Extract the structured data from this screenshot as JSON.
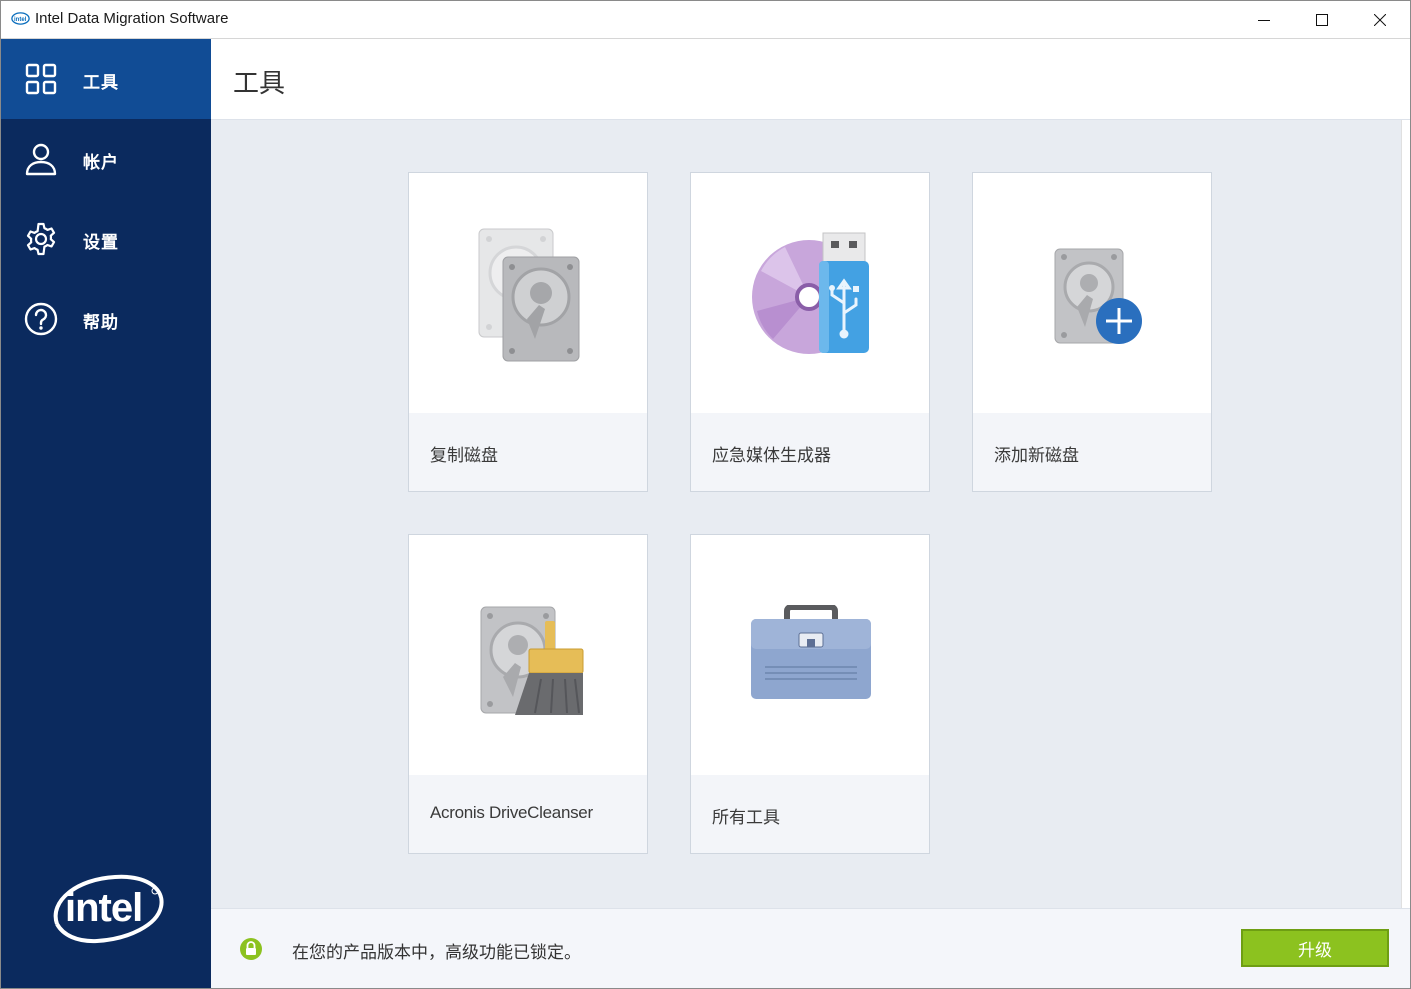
{
  "window": {
    "title": "Intel Data Migration Software"
  },
  "sidebar": {
    "items": [
      {
        "label": "工具",
        "icon": "grid-icon",
        "active": true
      },
      {
        "label": "帐户",
        "icon": "user-icon"
      },
      {
        "label": "设置",
        "icon": "gear-icon"
      },
      {
        "label": "帮助",
        "icon": "help-icon"
      }
    ],
    "logo": "intel"
  },
  "header": {
    "title": "工具"
  },
  "tools": [
    {
      "label": "复制磁盘",
      "icon": "clone-disk-icon"
    },
    {
      "label": "应急媒体生成器",
      "icon": "rescue-media-icon"
    },
    {
      "label": "添加新磁盘",
      "icon": "add-disk-icon"
    },
    {
      "label": "Acronis DriveCleanser",
      "icon": "drive-cleanser-icon"
    },
    {
      "label": "所有工具",
      "icon": "toolbox-icon"
    }
  ],
  "footer": {
    "message": "在您的产品版本中，高级功能已锁定。",
    "upgrade_label": "升级"
  },
  "colors": {
    "sidebar_bg": "#0b2a5e",
    "sidebar_active": "#114c95",
    "content_bg": "#e8ecf2",
    "upgrade_button": "#8cc21f"
  }
}
